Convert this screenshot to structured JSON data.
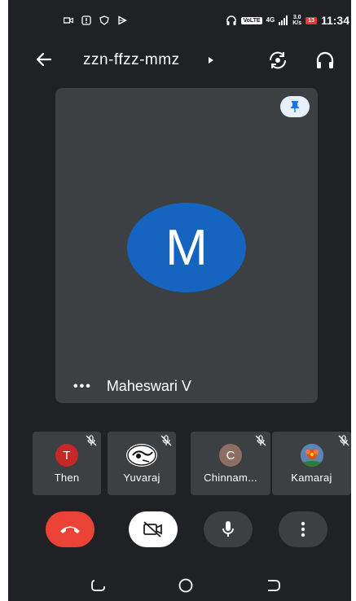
{
  "status_bar": {
    "time": "11:34",
    "volte": "VoLTE",
    "network": "4G",
    "speed_top": "3.0",
    "speed_bottom": "K/s",
    "battery": "13",
    "left_icons": [
      "video-icon",
      "alert-icon",
      "shield-icon",
      "play-icon"
    ]
  },
  "header": {
    "meeting_code": "zzn-ffzz-mmz"
  },
  "main_tile": {
    "avatar_initial": "M",
    "more_label": "•••",
    "participant_name": "Maheswari V",
    "avatar_color": "#1565c0"
  },
  "participants": [
    {
      "name": "Then",
      "initial": "T",
      "avatar_color": "#c62828",
      "avatar_type": "initial"
    },
    {
      "name": "Yuvaraj",
      "initial": "",
      "avatar_color": "#ffffff",
      "avatar_type": "photo"
    },
    {
      "name": "Chinnam...",
      "initial": "C",
      "avatar_color": "#8d6e63",
      "avatar_type": "initial"
    },
    {
      "name": "Kamaraj",
      "initial": "",
      "avatar_color": "#6d8fb3",
      "avatar_type": "photo"
    }
  ],
  "controls": {
    "end_call_color": "#ea4335",
    "items": [
      "end-call",
      "camera-off",
      "microphone",
      "more-options"
    ]
  },
  "nav": {
    "items": [
      "recent-apps",
      "home",
      "back"
    ]
  }
}
